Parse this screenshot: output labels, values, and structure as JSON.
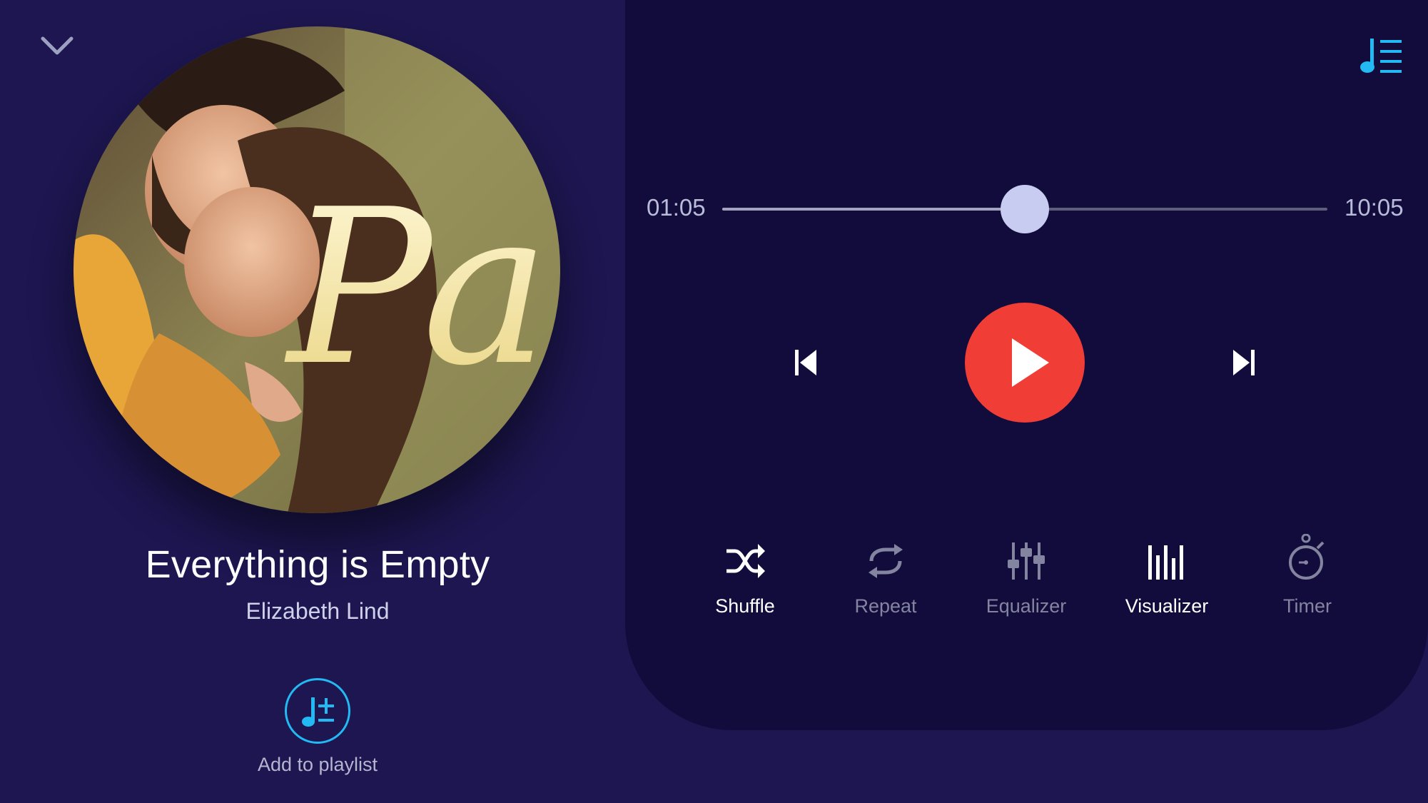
{
  "colors": {
    "left_bg": "#1d1650",
    "right_bg": "#120c3c",
    "accent": "#23b9f3",
    "play": "#f03e37"
  },
  "header": {
    "collapse_icon": "chevron-down-icon",
    "queue_icon": "music-queue-icon"
  },
  "album_art": {
    "text": "Pa"
  },
  "song": {
    "title": "Everything is Empty",
    "artist": "Elizabeth Lind"
  },
  "add_to_playlist": {
    "label": "Add to playlist",
    "icon": "playlist-add-icon"
  },
  "progress": {
    "current": "01:05",
    "total": "10:05",
    "fraction": 0.5
  },
  "controls": [
    {
      "label": "Shuffle",
      "icon": "shuffle-icon",
      "active": true
    },
    {
      "label": "Repeat",
      "icon": "repeat-icon",
      "active": false
    },
    {
      "label": "Equalizer",
      "icon": "equalizer-icon",
      "active": false
    },
    {
      "label": "Visualizer",
      "icon": "visualizer-icon",
      "active": true
    },
    {
      "label": "Timer",
      "icon": "timer-icon",
      "active": false
    }
  ]
}
